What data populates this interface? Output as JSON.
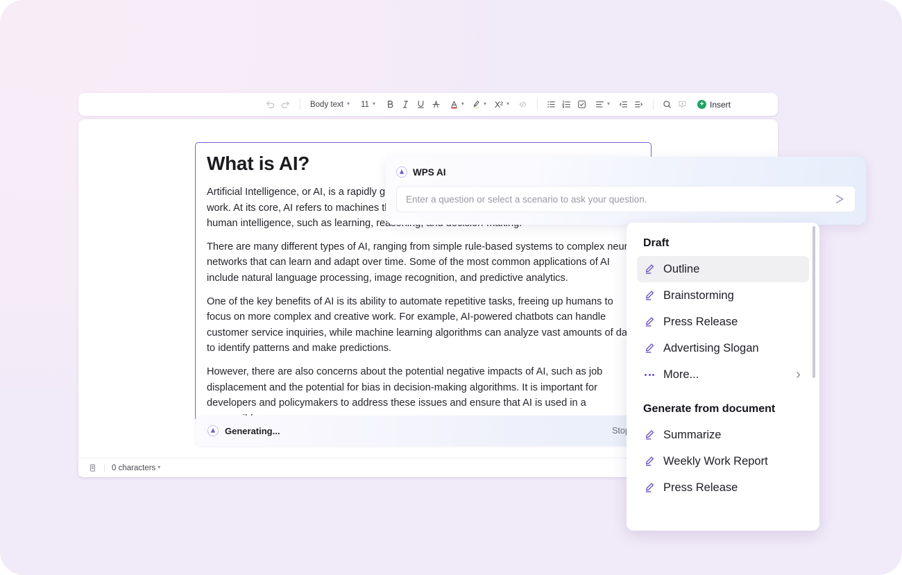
{
  "theme": {
    "background": "#f1eaf8",
    "accent_purple": "#6a4fc4",
    "doc_border": "#7a5fd3",
    "insert_green": "#21a366"
  },
  "toolbar": {
    "undo_icon": "undo-icon",
    "redo_icon": "redo-icon",
    "style_label": "Body text",
    "font_size": "11",
    "bold_label": "B",
    "italic_label": "I",
    "underline_label": "U",
    "strikethrough_icon": "strikethrough-icon",
    "font_color_icon": "font-color-icon",
    "highlight_icon": "highlighter-icon",
    "superscript_label": "X²",
    "code_icon": "code-icon",
    "bullet_list_icon": "bullet-list-icon",
    "numbered_list_icon": "numbered-list-icon",
    "checklist_icon": "checklist-icon",
    "align_icon": "align-icon",
    "outdent_icon": "decrease-indent-icon",
    "indent_icon": "increase-indent-icon",
    "search_icon": "search-icon",
    "comment_icon": "insert-comment-icon",
    "insert_label": "Insert"
  },
  "document": {
    "title": "What is AI?",
    "paragraphs": [
      "Artificial Intelligence, or AI, is a rapidly growing field that is transforming the way we live and work. At its core, AI refers to machines that can perform tasks that would normally require human intelligence, such as learning, reasoning, and decision-making.",
      "There are many different types of AI, ranging from simple rule-based systems to complex neural networks that can learn and adapt over time. Some of the most common applications of AI include natural language processing, image recognition, and predictive analytics.",
      "One of the key benefits of AI is its ability to automate repetitive tasks, freeing up humans to focus on more complex and creative work. For example, AI-powered chatbots can handle customer service inquiries, while machine learning algorithms can analyze vast amounts of data to identify patterns and make predictions.",
      "However, there are also concerns about the potential negative impacts of AI, such as job displacement and the potential for bias in decision-making algorithms. It is important for developers and policymakers to address these issues and ensure that AI is used in a responsible"
    ]
  },
  "generating": {
    "logo_icon": "wps-ai-logo-icon",
    "status_text": "Generating...",
    "stop_label": "Stop G"
  },
  "status_bar": {
    "page_icon": "page-layout-icon",
    "character_count": "0 characters",
    "view_web_icon": "web-view-icon",
    "view_page_icon": "page-view-icon"
  },
  "ai_panel": {
    "logo_icon": "wps-ai-logo-icon",
    "title": "WPS AI",
    "input_value": "",
    "input_placeholder": "Enter a question or select a scenario to ask your question.",
    "send_icon": "send-icon"
  },
  "ai_menu": {
    "sections": [
      {
        "title": "Draft",
        "items": [
          {
            "label": "Outline",
            "icon": "pencil-icon",
            "selected": true
          },
          {
            "label": "Brainstorming",
            "icon": "pencil-icon",
            "selected": false
          },
          {
            "label": "Press Release",
            "icon": "pencil-icon",
            "selected": false
          },
          {
            "label": "Advertising Slogan",
            "icon": "pencil-icon",
            "selected": false
          },
          {
            "label": "More...",
            "icon": "ellipsis-icon",
            "selected": false,
            "has_submenu": true
          }
        ]
      },
      {
        "title": "Generate from document",
        "items": [
          {
            "label": "Summarize",
            "icon": "pencil-icon",
            "selected": false
          },
          {
            "label": "Weekly Work Report",
            "icon": "pencil-icon",
            "selected": false
          },
          {
            "label": "Press Release",
            "icon": "pencil-icon",
            "selected": false
          }
        ]
      }
    ]
  }
}
